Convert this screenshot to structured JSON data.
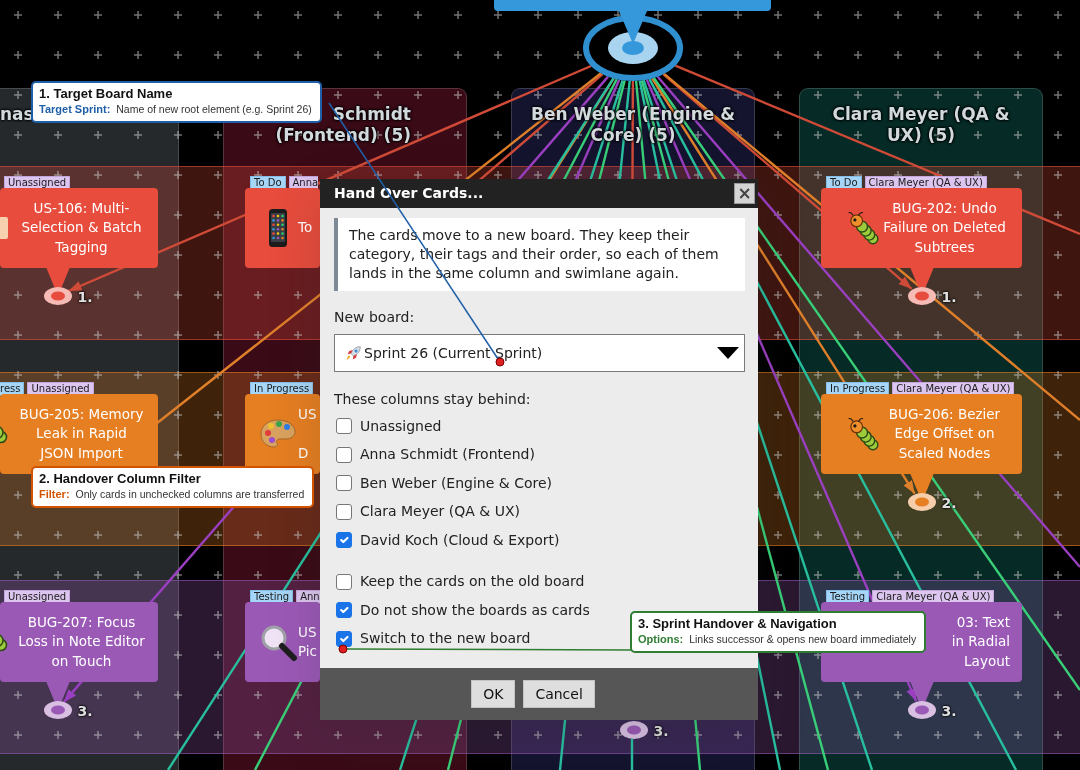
{
  "board": {
    "columns": [
      {
        "header": "nas",
        "color": "#25292b"
      },
      {
        "header": "Schmidt\n(Frontend) (5)",
        "color": "#3a0b17"
      },
      {
        "header": "Ben Weber (Engine &\nCore) (5)",
        "color": "#14142f"
      },
      {
        "header": "Clara Meyer (QA &\nUX) (5)",
        "color": "#062a25"
      }
    ],
    "swimlanes": [
      {
        "color": "#e74c3c",
        "cells": [
          {
            "kind": "story",
            "chips": [
              {
                "kind": "person",
                "text": "Unassigned"
              }
            ],
            "title": "US-106: Multi-\nSelection & Batch\nTagging",
            "node_label": "1."
          },
          {
            "kind": "mobile",
            "chips": [
              {
                "kind": "status",
                "text": "To Do"
              },
              {
                "kind": "person",
                "text": "Anna"
              }
            ],
            "title": "To"
          },
          {
            "kind": "covered"
          },
          {
            "kind": "bug",
            "chips": [
              {
                "kind": "status",
                "text": "To Do"
              },
              {
                "kind": "person",
                "text": "Clara Meyer (QA & UX)"
              }
            ],
            "title": "BUG-202: Undo\nFailure on Deleted\nSubtrees",
            "node_label": "1."
          }
        ]
      },
      {
        "color": "#e67e22",
        "cells": [
          {
            "kind": "bug",
            "chips": [
              {
                "kind": "status",
                "text": "ress"
              },
              {
                "kind": "person",
                "text": "Unassigned"
              }
            ],
            "title": "BUG-205: Memory\nLeak in Rapid\nJSON Import"
          },
          {
            "kind": "design",
            "chips": [
              {
                "kind": "status",
                "text": "In Progress"
              }
            ],
            "title": "US\n\nD"
          },
          {
            "kind": "covered"
          },
          {
            "kind": "bug",
            "chips": [
              {
                "kind": "status",
                "text": "In Progress"
              },
              {
                "kind": "person",
                "text": "Clara Meyer (QA & UX)"
              }
            ],
            "title": "BUG-206: Bezier\nEdge Offset on\nScaled Nodes",
            "node_label": "2."
          }
        ]
      },
      {
        "color": "#9b59b6",
        "cells": [
          {
            "kind": "bug",
            "chips": [
              {
                "kind": "person",
                "text": "Unassigned"
              }
            ],
            "title": "BUG-207: Focus\nLoss in Note Editor\non Touch",
            "node_label": "3."
          },
          {
            "kind": "search",
            "chips": [
              {
                "kind": "status",
                "text": "Testing"
              },
              {
                "kind": "person",
                "text": "Ann"
              }
            ],
            "title": "US\nPic"
          },
          {
            "kind": "node",
            "node_label": "3."
          },
          {
            "kind": "plain",
            "chips": [
              {
                "kind": "status",
                "text": "Testing"
              },
              {
                "kind": "person",
                "text": "Clara Meyer (QA & UX)"
              }
            ],
            "title": "03: Text\nin Radial\nLayout",
            "node_label": "3."
          }
        ]
      }
    ]
  },
  "dialog": {
    "title": "Hand Over Cards...",
    "close": "×",
    "info": "The cards move to a new board. They keep their category, their tags and their order, so each of them lands in the same column and swimlane again.",
    "board_label": "New board:",
    "board_select": {
      "value": "Sprint 26 (Current Sprint)"
    },
    "columns_label": "These columns stay behind:",
    "column_options": [
      {
        "label": "Unassigned",
        "checked": false
      },
      {
        "label": "Anna Schmidt (Frontend)",
        "checked": false
      },
      {
        "label": "Ben Weber (Engine & Core)",
        "checked": false
      },
      {
        "label": "Clara Meyer (QA & UX)",
        "checked": false
      },
      {
        "label": "David Koch (Cloud & Export)",
        "checked": true
      }
    ],
    "options": [
      {
        "label": "Keep the cards on the old board",
        "checked": false
      },
      {
        "label": "Do not show the boards as cards",
        "checked": true
      },
      {
        "label": "Switch to the new board",
        "checked": true
      }
    ],
    "buttons": [
      "OK",
      "Cancel"
    ]
  },
  "callouts": [
    {
      "title": "1. Target Board Name",
      "term": "Target Sprint:",
      "text": "Name of new root element (e.g. Sprint 26)",
      "color": "#1f5fa8"
    },
    {
      "title": "2. Handover Column Filter",
      "term": "Filter:",
      "text": "Only cards in unchecked columns are transferred",
      "color": "#d35400"
    },
    {
      "title": "3. Sprint Handover & Navigation",
      "term": "Options:",
      "text": "Links successor & opens new board immediately",
      "color": "#2e7d32"
    }
  ]
}
